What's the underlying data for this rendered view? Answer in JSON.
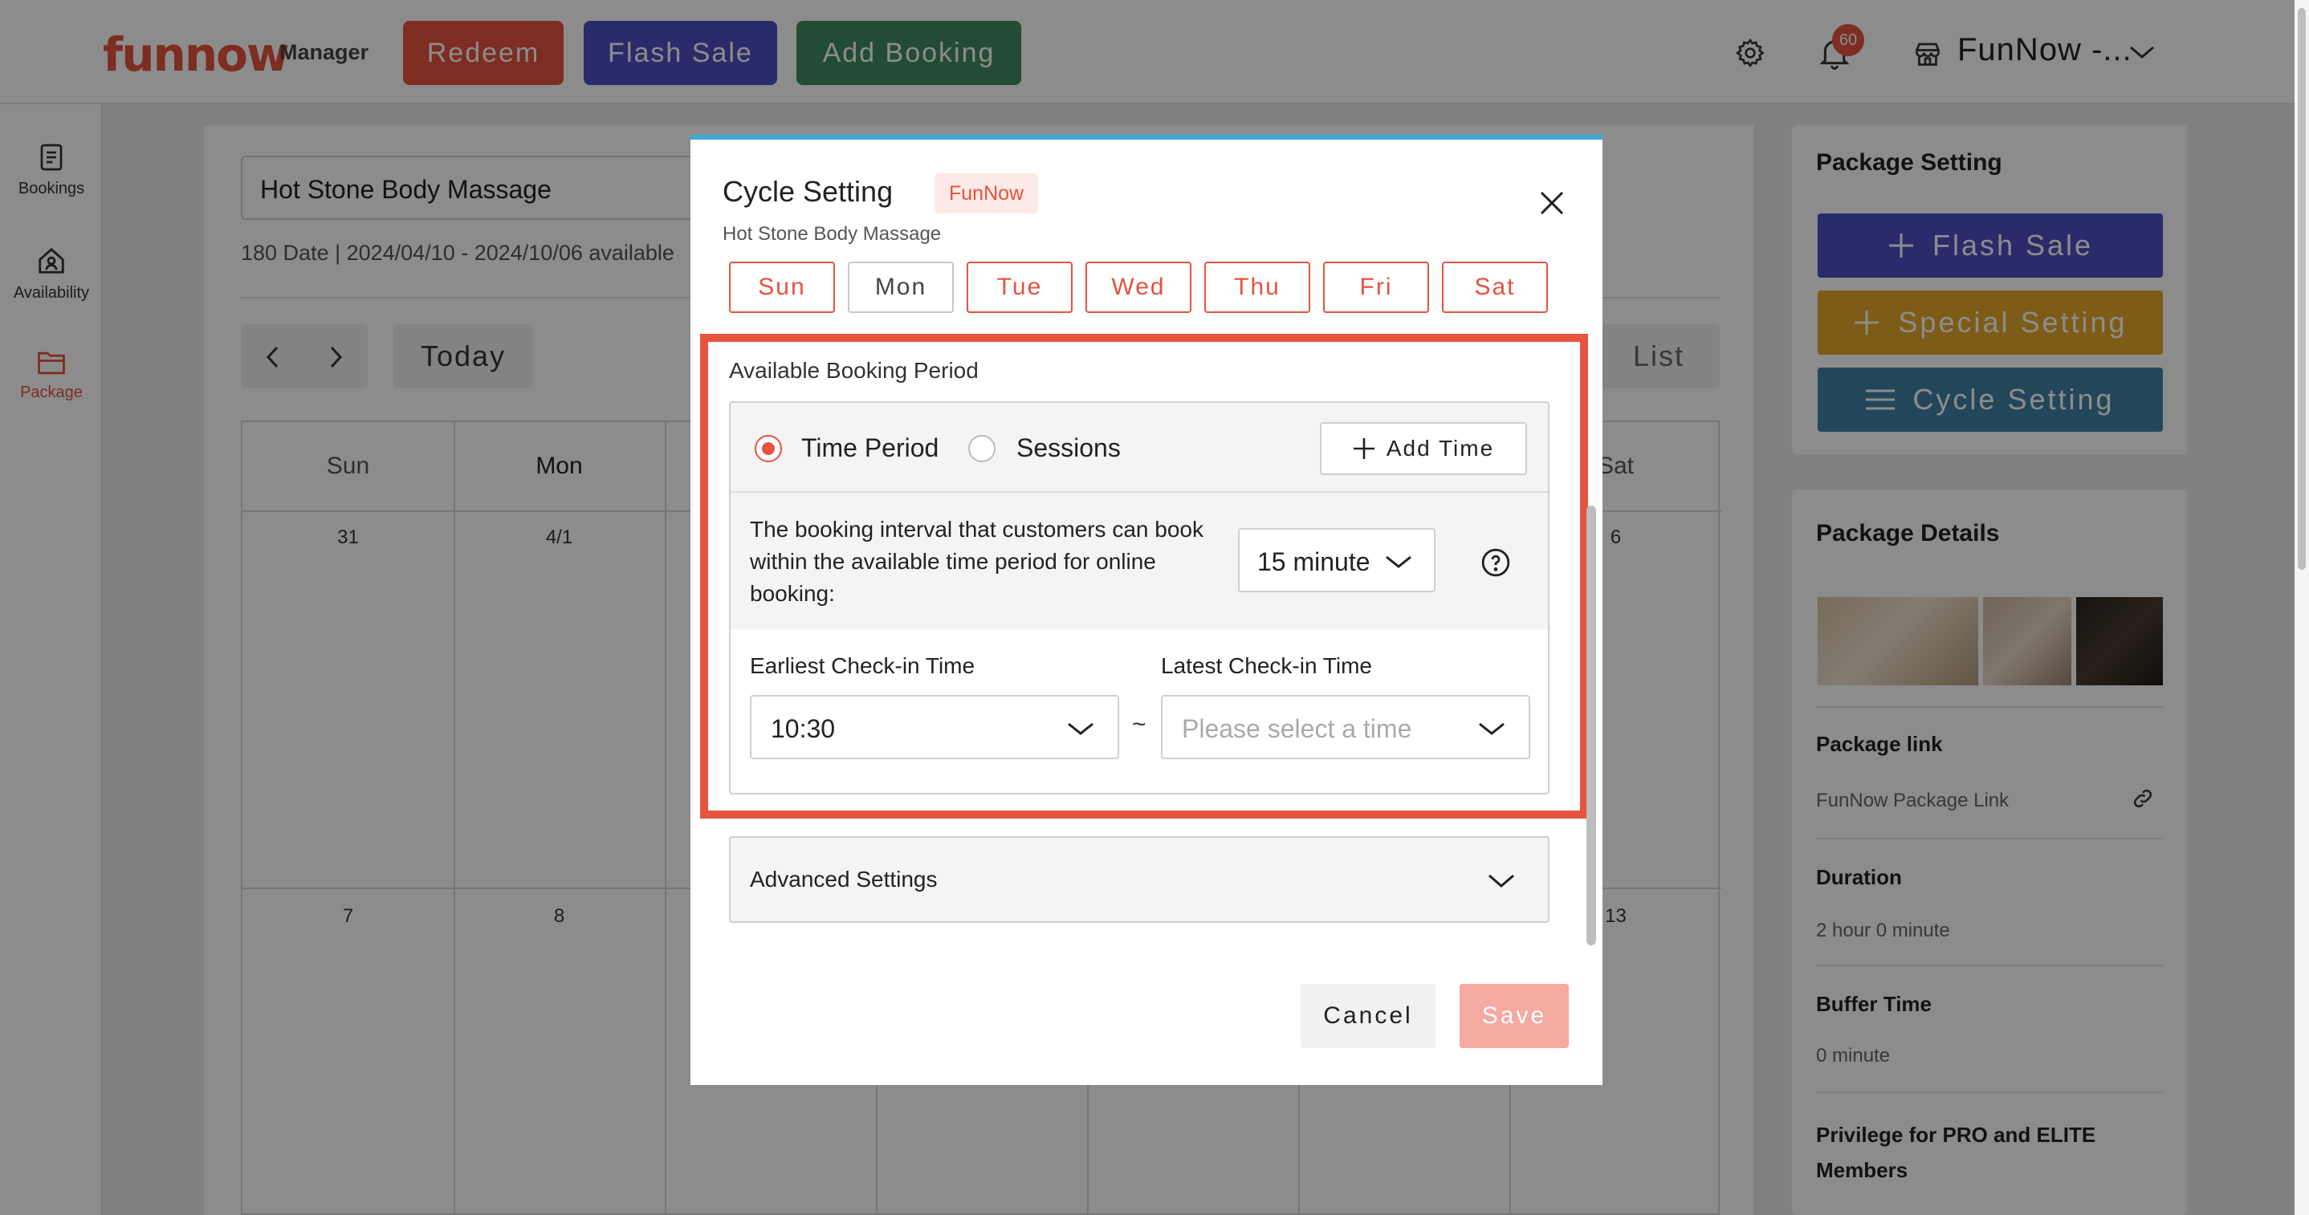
{
  "header": {
    "logo": "funnow",
    "logo_sub": "Manager",
    "buttons": [
      "Redeem",
      "Flash Sale",
      "Add Booking"
    ],
    "notification_count": "60",
    "store_name": "FunNow -..."
  },
  "sidebar": {
    "items": [
      {
        "label": "Bookings",
        "icon": "bookings-icon"
      },
      {
        "label": "Availability",
        "icon": "availability-icon"
      },
      {
        "label": "Package",
        "icon": "package-icon"
      }
    ],
    "active": "Package"
  },
  "main": {
    "package_name": "Hot Stone Body Massage",
    "availability": "180 Date | 2024/04/10 - 2024/10/06 available",
    "today_label": "Today",
    "list_label": "List",
    "weekdays": [
      "Sun",
      "Mon",
      "Sat"
    ],
    "week1": [
      "31",
      "4/1",
      "6"
    ],
    "week2": [
      "7",
      "8",
      "13"
    ]
  },
  "right_panel": {
    "setting_title": "Package Setting",
    "buttons": [
      "Flash Sale",
      "Special Setting",
      "Cycle Setting"
    ],
    "details_title": "Package Details",
    "link_label": "Package link",
    "link_value": "FunNow Package Link",
    "duration_label": "Duration",
    "duration_value": "2 hour 0 minute",
    "buffer_label": "Buffer Time",
    "buffer_value": "0 minute",
    "privilege_label": "Privilege for PRO and ELITE Members"
  },
  "modal": {
    "title": "Cycle Setting",
    "tag": "FunNow",
    "subtitle": "Hot Stone Body Massage",
    "days": [
      {
        "label": "Sun",
        "selected": true
      },
      {
        "label": "Mon",
        "selected": false
      },
      {
        "label": "Tue",
        "selected": true
      },
      {
        "label": "Wed",
        "selected": true
      },
      {
        "label": "Thu",
        "selected": true
      },
      {
        "label": "Fri",
        "selected": true
      },
      {
        "label": "Sat",
        "selected": true
      }
    ],
    "period_label": "Available Booking Period",
    "radio_time_period": "Time Period",
    "radio_sessions": "Sessions",
    "selected_mode": "Time Period",
    "add_time": "Add Time",
    "interval_text": "The booking interval that customers can book within the available time period for online booking:",
    "interval_value": "15 minute",
    "earliest_label": "Earliest Check-in Time",
    "earliest_value": "10:30",
    "latest_label": "Latest Check-in Time",
    "latest_placeholder": "Please select a time",
    "separator": "~",
    "advanced_label": "Advanced Settings",
    "cancel": "Cancel",
    "save": "Save"
  },
  "colors": {
    "brand": "#e4533d",
    "flash": "#4e4fc4",
    "add_booking": "#3f8a5d",
    "special": "#e3a82b",
    "cycle": "#3f82a4",
    "highlight": "#e8533f"
  }
}
